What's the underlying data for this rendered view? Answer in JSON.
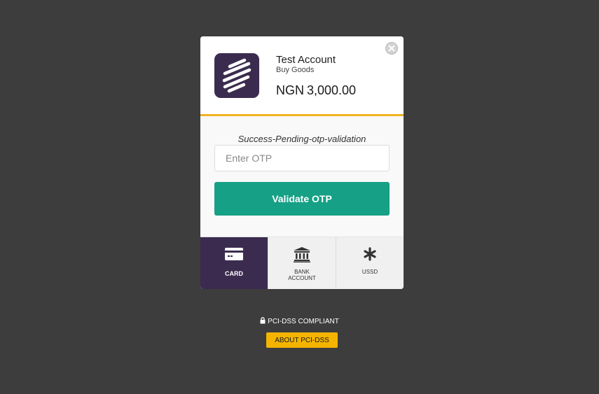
{
  "merchant": {
    "name": "Test Account",
    "description": "Buy Goods",
    "currency": "NGN",
    "amount": "3,000.00"
  },
  "otp": {
    "status_message": "Success-Pending-otp-validation",
    "placeholder": "Enter OTP",
    "value": "",
    "submit_label": "Validate OTP"
  },
  "tabs": [
    {
      "label": "CARD",
      "icon": "credit-card-icon",
      "active": true
    },
    {
      "label": "BANK ACCOUNT",
      "icon": "bank-icon",
      "active": false
    },
    {
      "label": "USSD",
      "icon": "asterisk-icon",
      "active": false
    }
  ],
  "footer": {
    "compliance_text": "PCI-DSS COMPLIANT",
    "about_label": "ABOUT PCI-DSS"
  },
  "colors": {
    "backdrop": "#3d3d3d",
    "brand_purple": "#3b2c4f",
    "accent_yellow": "#f0b323",
    "primary_green": "#16a085",
    "about_button": "#f4b400"
  }
}
